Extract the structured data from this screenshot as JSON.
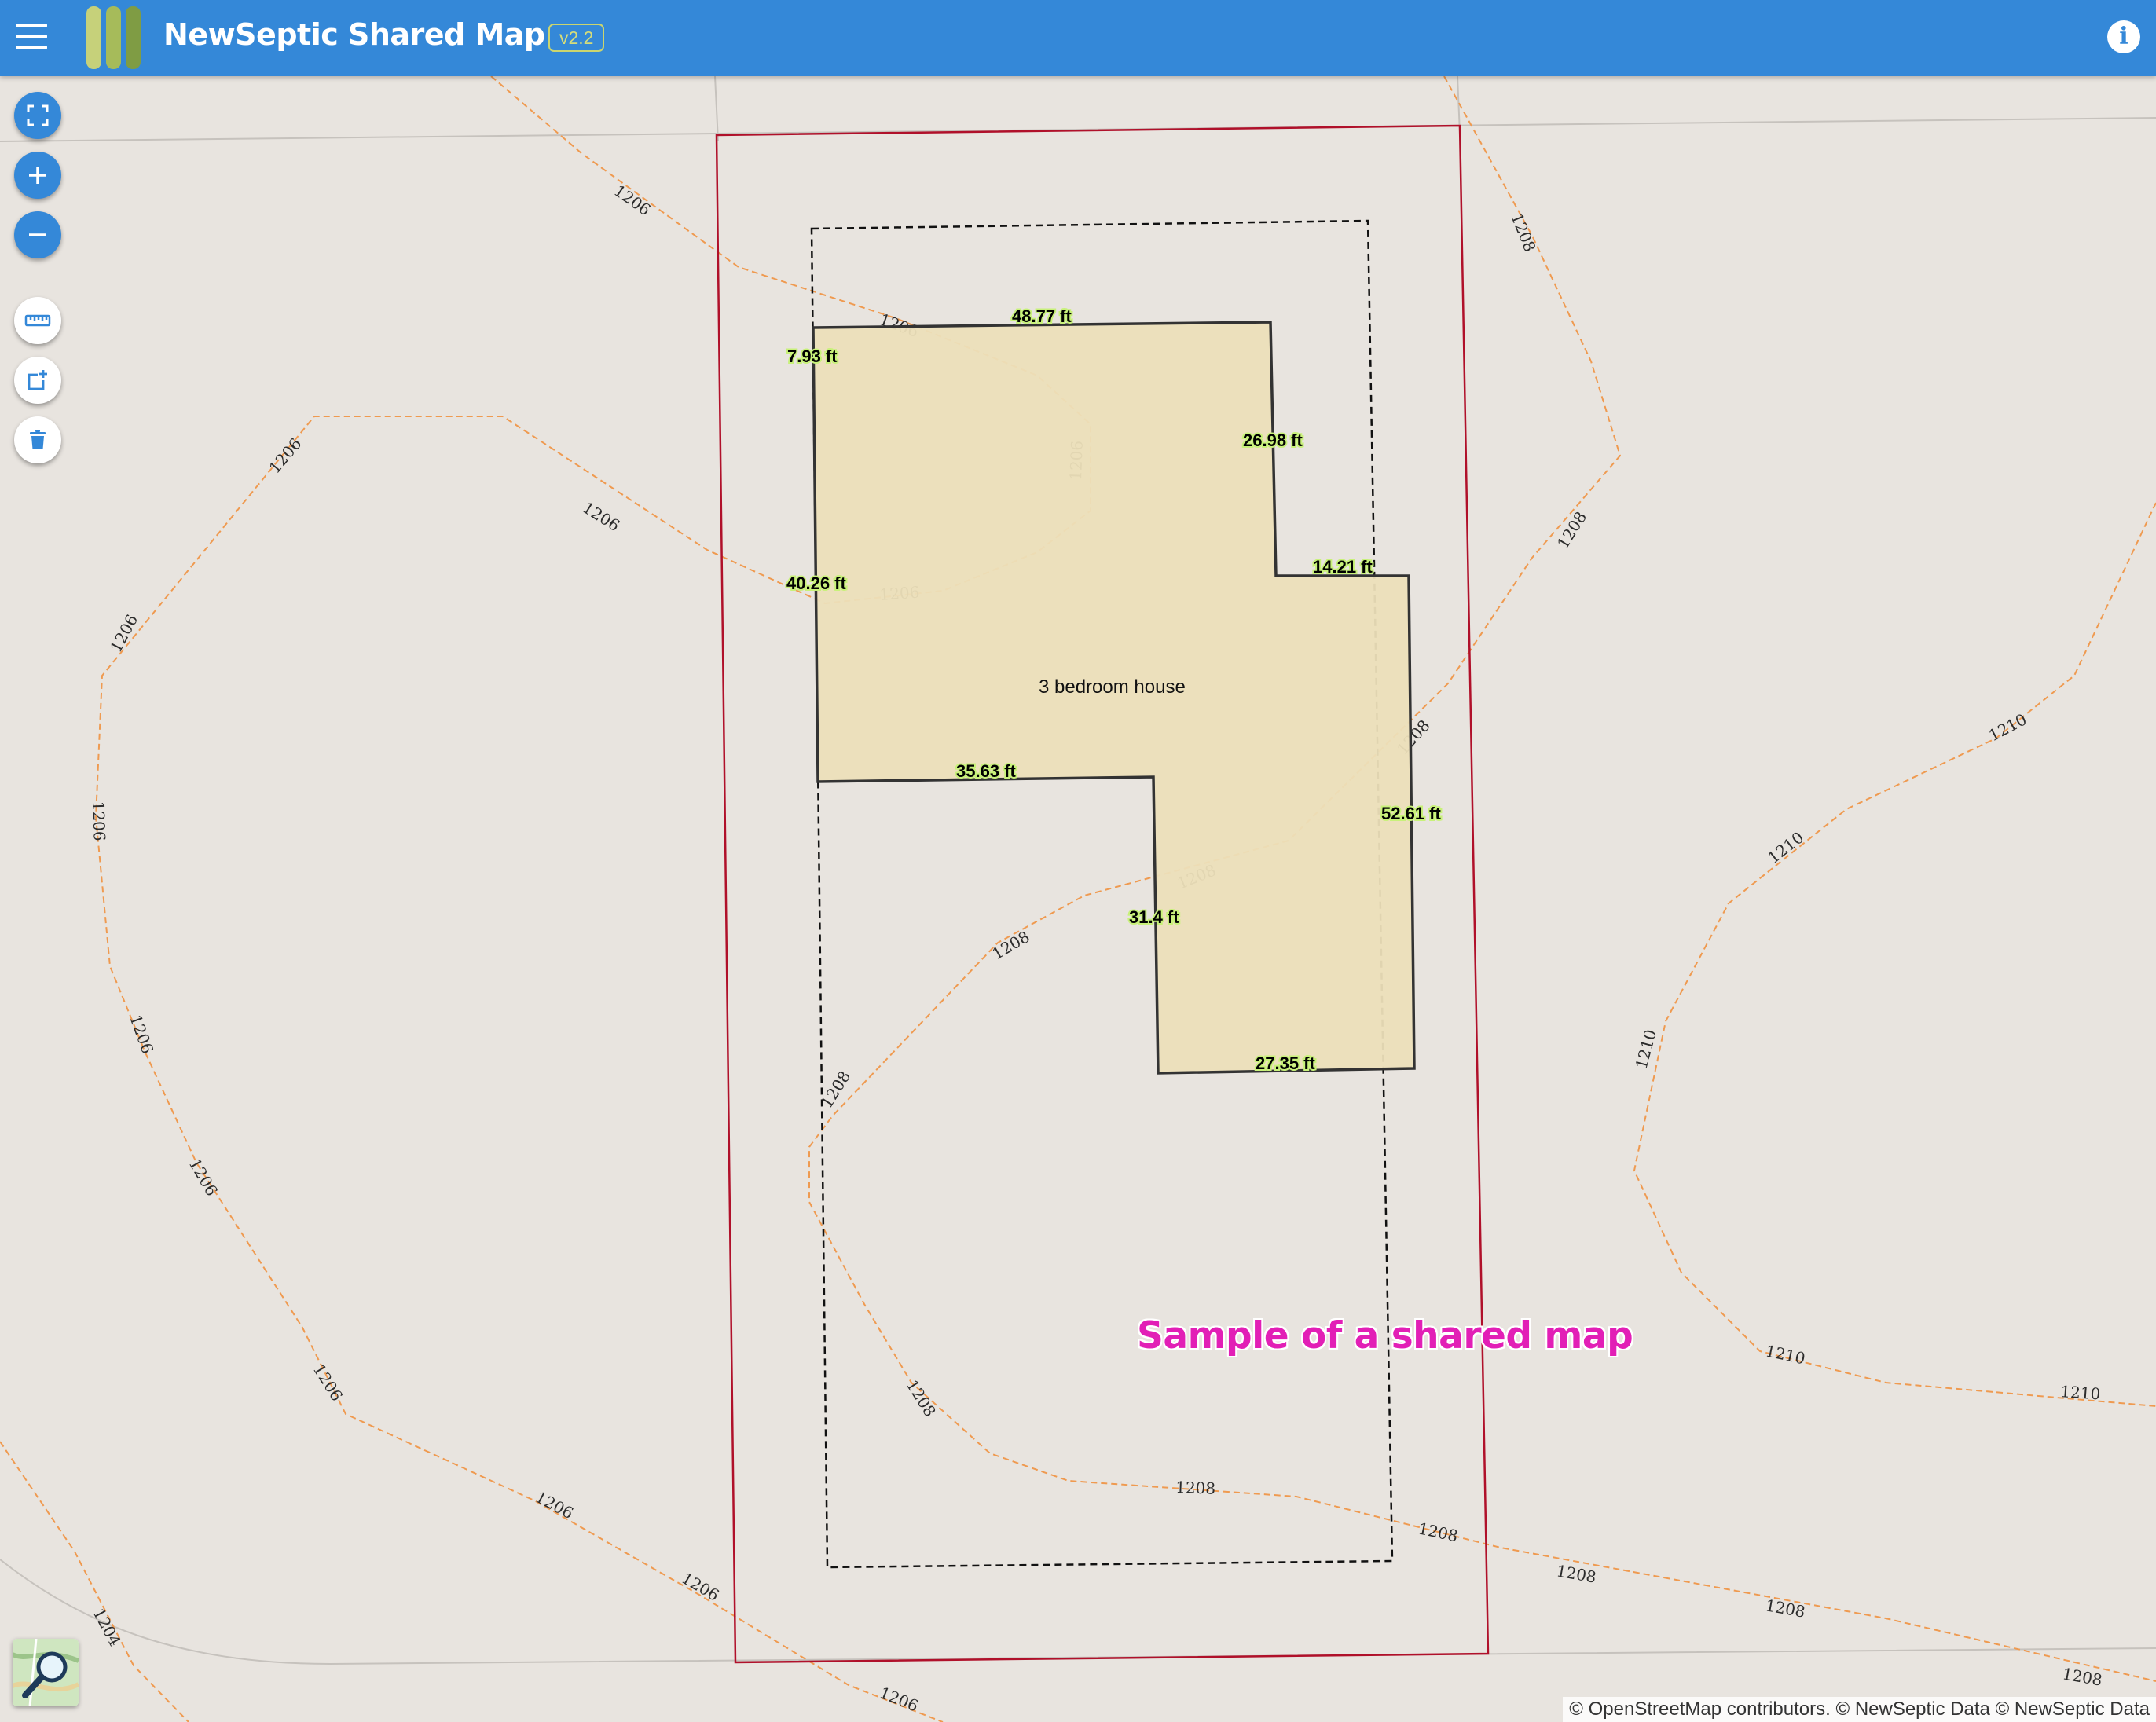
{
  "header": {
    "title": "NewSeptic Shared Map",
    "version": "v2.2",
    "menu_icon": "hamburger-menu-icon",
    "info_icon": "info-icon",
    "background_color": "#3488d8"
  },
  "toolbar": {
    "buttons": [
      {
        "name": "fullscreen",
        "icon": "fullscreen-icon"
      },
      {
        "name": "zoom-in",
        "icon": "plus-icon"
      },
      {
        "name": "zoom-out",
        "icon": "minus-icon"
      },
      {
        "name": "measure",
        "icon": "ruler-icon"
      },
      {
        "name": "add-shape",
        "icon": "add-shape-icon"
      },
      {
        "name": "delete",
        "icon": "trash-icon"
      }
    ]
  },
  "map": {
    "house_label": "3 bedroom house",
    "measurements": [
      "48.77 ft",
      "7.93 ft",
      "26.98 ft",
      "14.21 ft",
      "40.26 ft",
      "35.63 ft",
      "52.61 ft",
      "31.4 ft",
      "27.35 ft"
    ],
    "contour_labels": [
      "1204",
      "1206",
      "1208",
      "1210"
    ],
    "colors": {
      "property_line": "#b0102a",
      "contour": "#ef9a50",
      "house_fill": "#ecdfb9",
      "house_stroke": "#333333",
      "setback": "#111111"
    },
    "watermark": "Sample of a shared map",
    "watermark_color": "#e21fb6",
    "layer_toggle_icon": "map-search-icon"
  },
  "attribution": {
    "osm_prefix": "© ",
    "osm_link": "OpenStreetMap",
    "osm_suffix": " contributors.",
    "rest": " © NewSeptic Data © NewSeptic Data"
  }
}
